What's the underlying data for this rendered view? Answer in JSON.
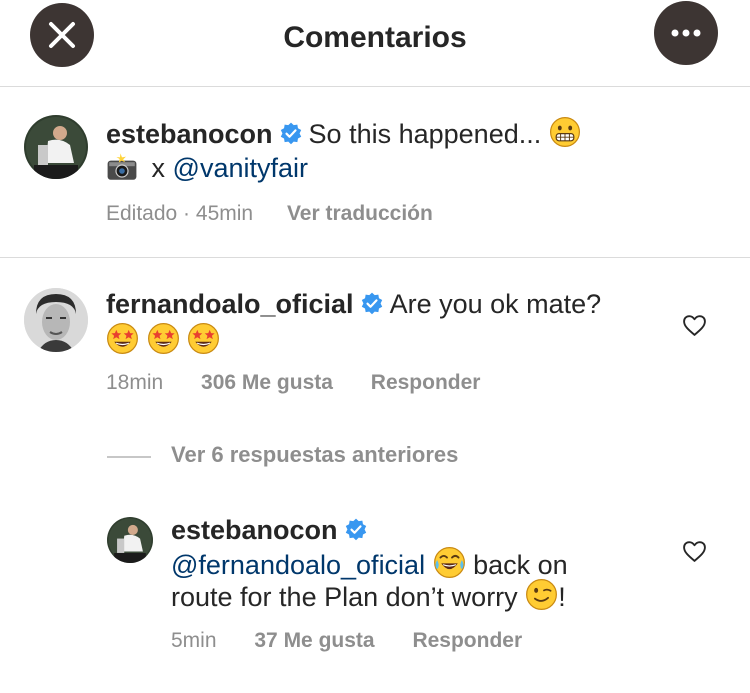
{
  "header": {
    "title": "Comentarios",
    "close_icon": "close-icon",
    "more_icon": "more-options-icon"
  },
  "caption": {
    "username": "estebanocon",
    "text": "So this happened...",
    "emoji": "grimacing-face",
    "line2_mention": "@vanityfair",
    "line2_prefix_icon": "camera-with-flash",
    "line2_x": "x",
    "edited": "Editado · 45min",
    "translate": "Ver traducción"
  },
  "comments": [
    {
      "username": "fernandoalo_oficial",
      "text": "Are you ok mate?",
      "emojis": [
        "star-struck",
        "star-struck",
        "star-struck"
      ],
      "time": "18min",
      "likes": "306 Me gusta",
      "reply": "Responder"
    }
  ],
  "view_replies": "Ver 6 respuestas anteriores",
  "reply": {
    "username": "estebanocon",
    "mention": "@fernandoalo_oficial",
    "text1": "back on",
    "text2": "route for the Plan don’t worry",
    "text3": "!",
    "time": "5min",
    "likes": "37 Me gusta",
    "reply": "Responder"
  },
  "colors": {
    "mention": "#00376b",
    "verified": "#3897f0",
    "meta": "#8e8e8e",
    "header_button": "#3d3533"
  }
}
